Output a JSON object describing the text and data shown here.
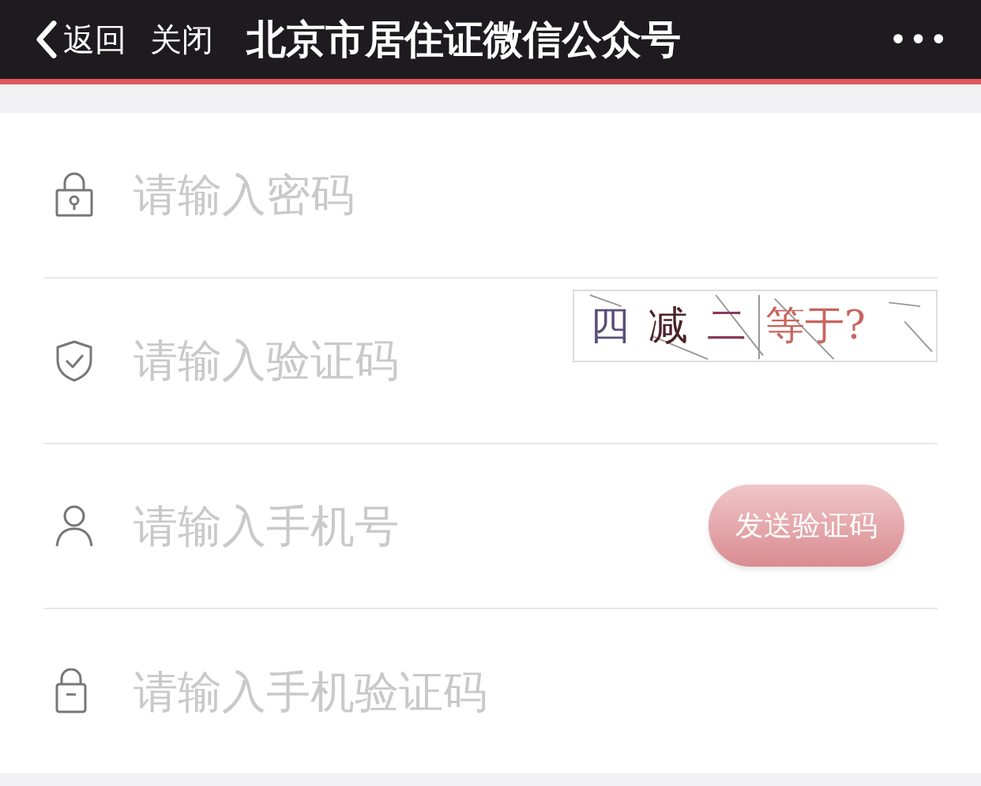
{
  "header": {
    "back": "返回",
    "close": "关闭",
    "title": "北京市居住证微信公众号",
    "more": "•••"
  },
  "fields": [
    {
      "kind": "padlock",
      "placeholder": "请输入密码"
    },
    {
      "kind": "shield",
      "placeholder": "请输入验证码",
      "captcha": [
        {
          "text": "四",
          "color": "#5a4f7a"
        },
        {
          "text": "减",
          "color": "#4a2228"
        },
        {
          "text": "二",
          "color": "#8a3a5a"
        },
        {
          "text": "等于?",
          "color": "#c8655e"
        }
      ]
    },
    {
      "kind": "person",
      "placeholder": "请输入手机号",
      "button": "发送验证码"
    },
    {
      "kind": "lock",
      "placeholder": "请输入手机验证码"
    }
  ]
}
